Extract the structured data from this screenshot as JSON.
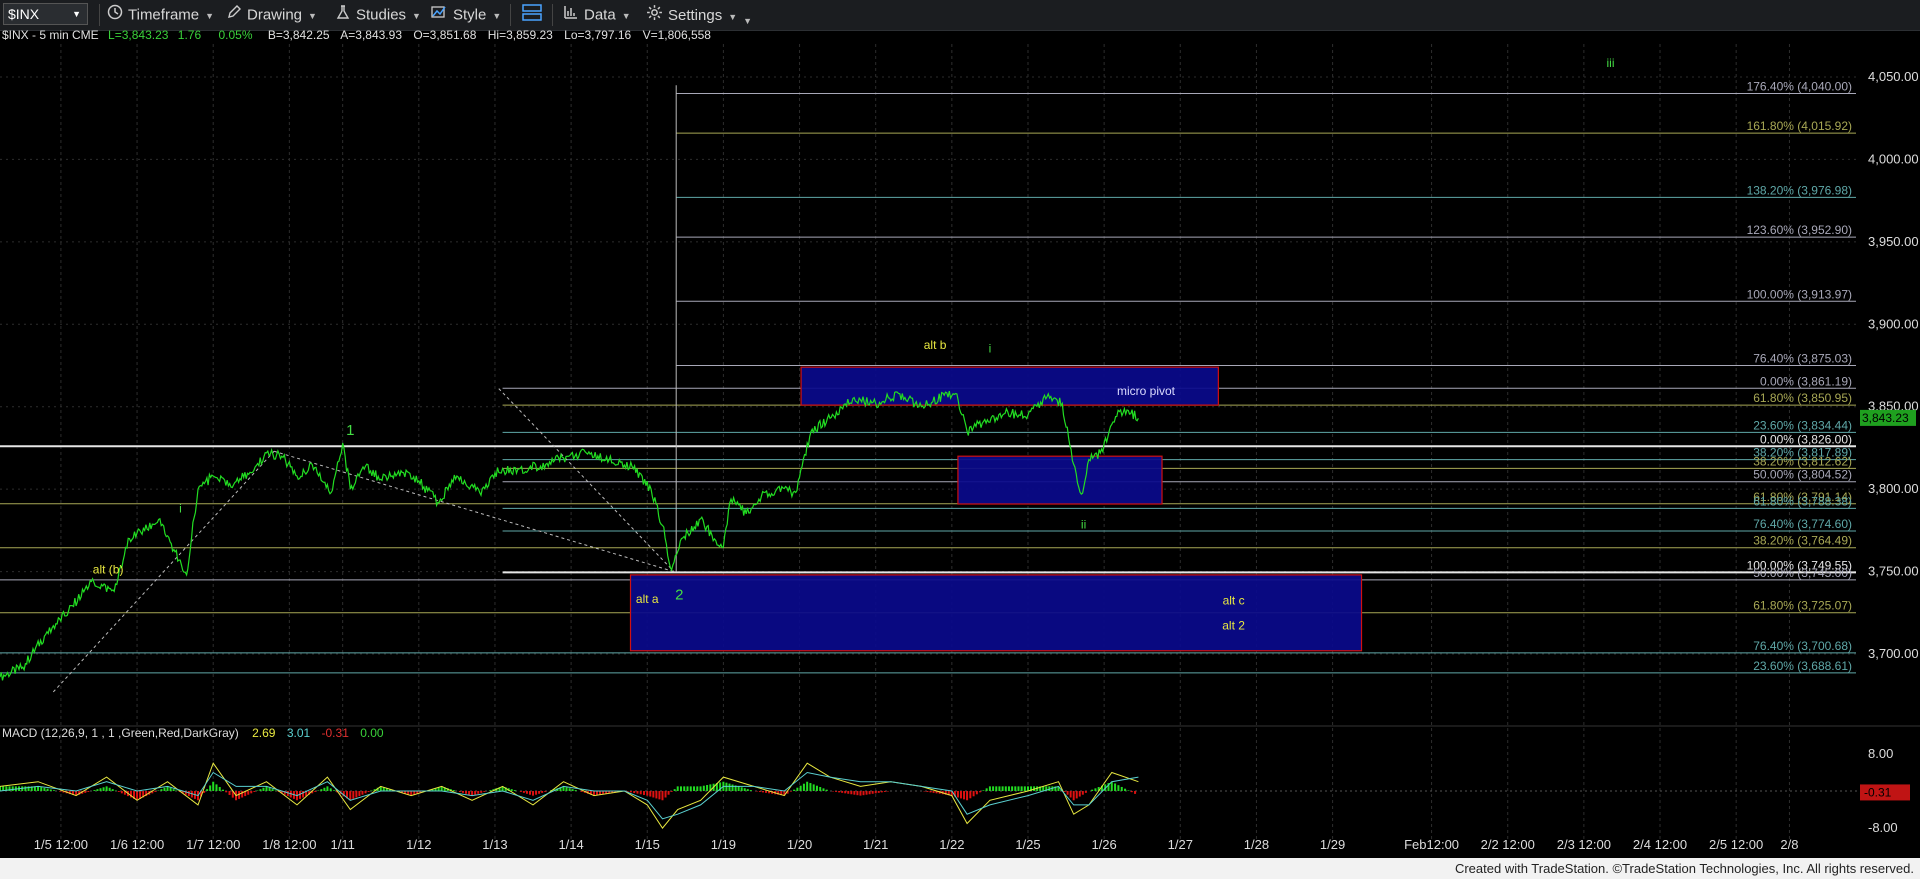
{
  "toolbar": {
    "symbol": "$INX",
    "timeframe": "Timeframe",
    "drawing": "Drawing",
    "studies": "Studies",
    "style": "Style",
    "data": "Data",
    "settings": "Settings"
  },
  "header": {
    "symbol_interval": "$INX - 5 min  CME",
    "last": "L=3,843.23",
    "change": "1.76",
    "change_pct": "0.05%",
    "bid": "B=3,842.25",
    "ask": "A=3,843.93",
    "open": "O=3,851.68",
    "high": "Hi=3,859.23",
    "low": "Lo=3,797.16",
    "volume": "V=1,806,558"
  },
  "footer": "Created with TradeStation. ©TradeStation Technologies, Inc. All rights reserved.",
  "colors": {
    "price": "#22dd22",
    "grid": "#2d2d2d",
    "box_fill": "#0a0a8c",
    "box_edge": "#d01010",
    "fib_gray": "#a8a8b8",
    "fib_olive": "#a8a855",
    "fib_teal": "#5fa8a8",
    "label_yellow": "#e8e840",
    "label_green": "#44dd44",
    "macd_pos": "#22dd22",
    "macd_neg": "#dd1111"
  },
  "chart_data": {
    "type": "line",
    "title": "$INX - 5 min",
    "ylim": [
      3660,
      4070
    ],
    "y_ticks": [
      3700,
      3750,
      3800,
      3850,
      3900,
      3950,
      4000,
      4050
    ],
    "y_tick_labels": [
      "3,700.00",
      "3,750.00",
      "3,800.00",
      "3,850.00",
      "3,900.00",
      "3,950.00",
      "4,000.00",
      "4,050.00"
    ],
    "x_slots": [
      {
        "label": "1/5 12:00",
        "i": 0.8
      },
      {
        "label": "1/6 12:00",
        "i": 1.8
      },
      {
        "label": "1/7 12:00",
        "i": 2.8
      },
      {
        "label": "1/8 12:00",
        "i": 3.8
      },
      {
        "label": "1/11",
        "i": 4.5
      },
      {
        "label": "1/12",
        "i": 5.5
      },
      {
        "label": "1/13",
        "i": 6.5
      },
      {
        "label": "1/14",
        "i": 7.5
      },
      {
        "label": "1/15",
        "i": 8.5
      },
      {
        "label": "1/19",
        "i": 9.5
      },
      {
        "label": "1/20",
        "i": 10.5
      },
      {
        "label": "1/21",
        "i": 11.5
      },
      {
        "label": "1/22",
        "i": 12.5
      },
      {
        "label": "1/25",
        "i": 13.5
      },
      {
        "label": "1/26",
        "i": 14.5
      },
      {
        "label": "1/27",
        "i": 15.5
      },
      {
        "label": "1/28",
        "i": 16.5
      },
      {
        "label": "1/29",
        "i": 17.5
      },
      {
        "label": "Feb12:00",
        "i": 18.8
      },
      {
        "label": "2/2 12:00",
        "i": 19.8
      },
      {
        "label": "2/3 12:00",
        "i": 20.8
      },
      {
        "label": "2/4 12:00",
        "i": 21.8
      },
      {
        "label": "2/5 12:00",
        "i": 22.8
      },
      {
        "label": "2/8",
        "i": 23.5
      }
    ],
    "x_range": [
      0,
      24.4
    ],
    "series": [
      {
        "name": "$INX",
        "points": [
          [
            0,
            3686
          ],
          [
            0.3,
            3692
          ],
          [
            0.6,
            3712
          ],
          [
            0.9,
            3726
          ],
          [
            1.2,
            3744
          ],
          [
            1.5,
            3738
          ],
          [
            1.7,
            3770
          ],
          [
            1.9,
            3775
          ],
          [
            2.1,
            3782
          ],
          [
            2.3,
            3762
          ],
          [
            2.45,
            3748
          ],
          [
            2.6,
            3800
          ],
          [
            2.8,
            3808
          ],
          [
            3.0,
            3802
          ],
          [
            3.3,
            3810
          ],
          [
            3.5,
            3822
          ],
          [
            3.7,
            3820
          ],
          [
            3.9,
            3808
          ],
          [
            4.1,
            3815
          ],
          [
            4.35,
            3798
          ],
          [
            4.5,
            3828
          ],
          [
            4.6,
            3800
          ],
          [
            4.8,
            3814
          ],
          [
            5.0,
            3806
          ],
          [
            5.3,
            3810
          ],
          [
            5.5,
            3805
          ],
          [
            5.75,
            3792
          ],
          [
            6.0,
            3808
          ],
          [
            6.3,
            3798
          ],
          [
            6.5,
            3810
          ],
          [
            6.8,
            3812
          ],
          [
            7.1,
            3814
          ],
          [
            7.4,
            3819
          ],
          [
            7.7,
            3822
          ],
          [
            8.0,
            3818
          ],
          [
            8.3,
            3814
          ],
          [
            8.55,
            3800
          ],
          [
            8.7,
            3778
          ],
          [
            8.82,
            3751
          ],
          [
            8.95,
            3770
          ],
          [
            9.2,
            3782
          ],
          [
            9.35,
            3772
          ],
          [
            9.5,
            3765
          ],
          [
            9.6,
            3794
          ],
          [
            9.8,
            3785
          ],
          [
            10.0,
            3796
          ],
          [
            10.2,
            3800
          ],
          [
            10.45,
            3798
          ],
          [
            10.65,
            3835
          ],
          [
            10.9,
            3843
          ],
          [
            11.2,
            3855
          ],
          [
            11.5,
            3852
          ],
          [
            11.8,
            3858
          ],
          [
            12.1,
            3850
          ],
          [
            12.4,
            3857
          ],
          [
            12.55,
            3858
          ],
          [
            12.7,
            3835
          ],
          [
            12.9,
            3840
          ],
          [
            13.2,
            3846
          ],
          [
            13.5,
            3845
          ],
          [
            13.75,
            3856
          ],
          [
            13.95,
            3852
          ],
          [
            14.1,
            3815
          ],
          [
            14.2,
            3797
          ],
          [
            14.3,
            3818
          ],
          [
            14.45,
            3822
          ],
          [
            14.65,
            3844
          ],
          [
            14.8,
            3848
          ],
          [
            14.95,
            3843
          ]
        ]
      }
    ],
    "fib_levels": [
      {
        "value": 4040.0,
        "label": "176.40% (4,040.00)",
        "tone": "gray",
        "from": 8.88
      },
      {
        "value": 4015.92,
        "label": "161.80% (4,015.92)",
        "tone": "olive",
        "from": 8.88
      },
      {
        "value": 3976.98,
        "label": "138.20% (3,976.98)",
        "tone": "teal",
        "from": 8.88
      },
      {
        "value": 3952.9,
        "label": "123.60% (3,952.90)",
        "tone": "gray",
        "from": 8.88
      },
      {
        "value": 3913.97,
        "label": "100.00% (3,913.97)",
        "tone": "gray",
        "from": 8.88
      },
      {
        "value": 3875.03,
        "label": "76.40% (3,875.03)",
        "tone": "gray",
        "from": 8.88
      },
      {
        "value": 3861.19,
        "label": "0.00% (3,861.19)",
        "tone": "gray",
        "from": 6.6
      },
      {
        "value": 3850.95,
        "label": "61.80% (3,850.95)",
        "tone": "olive",
        "from": 6.6
      },
      {
        "value": 3834.44,
        "label": "23.60% (3,834.44)",
        "tone": "teal",
        "from": 6.6
      },
      {
        "value": 3826.0,
        "label": "0.00% (3,826.00)",
        "tone": "white",
        "from": 0
      },
      {
        "value": 3817.89,
        "label": "38.20% (3,817.89)",
        "tone": "teal",
        "from": 6.6
      },
      {
        "value": 3812.62,
        "label": "38.20% (3,812.62)",
        "tone": "olive",
        "from": 6.6
      },
      {
        "value": 3804.52,
        "label": "50.00% (3,804.52)",
        "tone": "gray",
        "from": 6.6
      },
      {
        "value": 3791.14,
        "label": "61.80% (3,791.14)",
        "tone": "olive",
        "from": 0
      },
      {
        "value": 3788.38,
        "label": "61.80% (3,788.38)",
        "tone": "teal",
        "from": 6.6
      },
      {
        "value": 3774.6,
        "label": "76.40% (3,774.60)",
        "tone": "teal",
        "from": 6.6
      },
      {
        "value": 3764.49,
        "label": "38.20% (3,764.49)",
        "tone": "olive",
        "from": 0
      },
      {
        "value": 3749.55,
        "label": "100.00% (3,749.55)",
        "tone": "white",
        "from": 6.6
      },
      {
        "value": 3745.0,
        "label": "50.00% (3,745.00)",
        "tone": "gray",
        "from": 0
      },
      {
        "value": 3725.07,
        "label": "61.80% (3,725.07)",
        "tone": "olive",
        "from": 0
      },
      {
        "value": 3700.68,
        "label": "76.40% (3,700.68)",
        "tone": "teal",
        "from": 0
      },
      {
        "value": 3688.61,
        "label": "23.60% (3,688.61)",
        "tone": "teal",
        "from": 0
      }
    ],
    "last_price": {
      "value": 3843.23,
      "label": "3,843.23"
    },
    "boxes": [
      {
        "name": "upper",
        "x": [
          10.52,
          16.0
        ],
        "y": [
          3851,
          3874
        ]
      },
      {
        "name": "middle",
        "x": [
          12.58,
          15.26
        ],
        "y": [
          3791,
          3820
        ]
      },
      {
        "name": "lower",
        "x": [
          8.28,
          17.88
        ],
        "y": [
          3702,
          3748
        ]
      }
    ],
    "annotations": [
      {
        "text": "1",
        "x": 4.6,
        "y": 3833,
        "color": "green"
      },
      {
        "text": "i",
        "x": 2.37,
        "y": 3786,
        "color": "green"
      },
      {
        "text": "alt (b)",
        "x": 1.42,
        "y": 3749,
        "color": "yellow"
      },
      {
        "text": "alt a",
        "x": 8.5,
        "y": 3731,
        "color": "yellow"
      },
      {
        "text": "2",
        "x": 8.92,
        "y": 3733,
        "color": "green"
      },
      {
        "text": "alt b",
        "x": 12.28,
        "y": 3885,
        "color": "yellow"
      },
      {
        "text": "i",
        "x": 13.0,
        "y": 3883,
        "color": "green"
      },
      {
        "text": "micro pivot",
        "x": 15.05,
        "y": 3857,
        "color": "white"
      },
      {
        "text": "ii",
        "x": 14.23,
        "y": 3776,
        "color": "green"
      },
      {
        "text": "alt c",
        "x": 16.2,
        "y": 3730,
        "color": "yellow"
      },
      {
        "text": "alt 2",
        "x": 16.2,
        "y": 3715,
        "color": "yellow"
      },
      {
        "text": "iii",
        "x": 21.15,
        "y": 4056,
        "color": "green"
      }
    ],
    "macd": {
      "label": "MACD (12,26,9, 1 , 1 ,Green,Red,DarkGray)",
      "values": [
        "2.69",
        "3.01",
        "-0.31",
        "0.00"
      ],
      "ylim": [
        -11,
        11
      ],
      "y_ticks": [
        8,
        -8
      ],
      "y_tick_labels": [
        "8.00",
        "-8.00"
      ],
      "current": {
        "value": -0.31,
        "label": "-0.31"
      },
      "macd_line": [
        [
          0,
          1
        ],
        [
          0.5,
          2
        ],
        [
          1.0,
          -1
        ],
        [
          1.4,
          3
        ],
        [
          1.8,
          -2
        ],
        [
          2.2,
          2
        ],
        [
          2.6,
          -3
        ],
        [
          2.8,
          6
        ],
        [
          3.1,
          -1
        ],
        [
          3.5,
          2
        ],
        [
          3.9,
          -3
        ],
        [
          4.3,
          3
        ],
        [
          4.6,
          -4
        ],
        [
          5.0,
          1
        ],
        [
          5.4,
          -1
        ],
        [
          5.8,
          1
        ],
        [
          6.2,
          -2
        ],
        [
          6.6,
          1
        ],
        [
          7.0,
          -3
        ],
        [
          7.4,
          2
        ],
        [
          7.8,
          -1
        ],
        [
          8.2,
          0
        ],
        [
          8.5,
          -3
        ],
        [
          8.7,
          -8
        ],
        [
          8.9,
          -4
        ],
        [
          9.2,
          -2
        ],
        [
          9.5,
          3
        ],
        [
          9.9,
          1
        ],
        [
          10.3,
          -1
        ],
        [
          10.6,
          6
        ],
        [
          10.9,
          3
        ],
        [
          11.3,
          1
        ],
        [
          11.7,
          2
        ],
        [
          12.1,
          1
        ],
        [
          12.5,
          -1
        ],
        [
          12.7,
          -7
        ],
        [
          13.0,
          -2
        ],
        [
          13.5,
          0
        ],
        [
          13.9,
          2
        ],
        [
          14.1,
          -5
        ],
        [
          14.3,
          -3
        ],
        [
          14.6,
          4
        ],
        [
          14.95,
          2
        ]
      ],
      "signal_line": [
        [
          0,
          0
        ],
        [
          0.5,
          1
        ],
        [
          1.0,
          0
        ],
        [
          1.4,
          2
        ],
        [
          1.8,
          0
        ],
        [
          2.2,
          1
        ],
        [
          2.6,
          -1
        ],
        [
          2.8,
          4
        ],
        [
          3.1,
          1
        ],
        [
          3.5,
          1
        ],
        [
          3.9,
          -1
        ],
        [
          4.3,
          2
        ],
        [
          4.6,
          -2
        ],
        [
          5.0,
          0
        ],
        [
          5.4,
          0
        ],
        [
          5.8,
          0
        ],
        [
          6.2,
          -1
        ],
        [
          6.6,
          0
        ],
        [
          7.0,
          -2
        ],
        [
          7.4,
          1
        ],
        [
          7.8,
          0
        ],
        [
          8.2,
          0
        ],
        [
          8.5,
          -2
        ],
        [
          8.7,
          -6
        ],
        [
          8.9,
          -5
        ],
        [
          9.2,
          -3
        ],
        [
          9.5,
          1
        ],
        [
          9.9,
          1
        ],
        [
          10.3,
          0
        ],
        [
          10.6,
          4
        ],
        [
          10.9,
          3
        ],
        [
          11.3,
          2
        ],
        [
          11.7,
          2
        ],
        [
          12.1,
          1
        ],
        [
          12.5,
          0
        ],
        [
          12.7,
          -5
        ],
        [
          13.0,
          -3
        ],
        [
          13.5,
          -1
        ],
        [
          13.9,
          1
        ],
        [
          14.1,
          -3
        ],
        [
          14.3,
          -3
        ],
        [
          14.6,
          2
        ],
        [
          14.95,
          3
        ]
      ]
    }
  }
}
